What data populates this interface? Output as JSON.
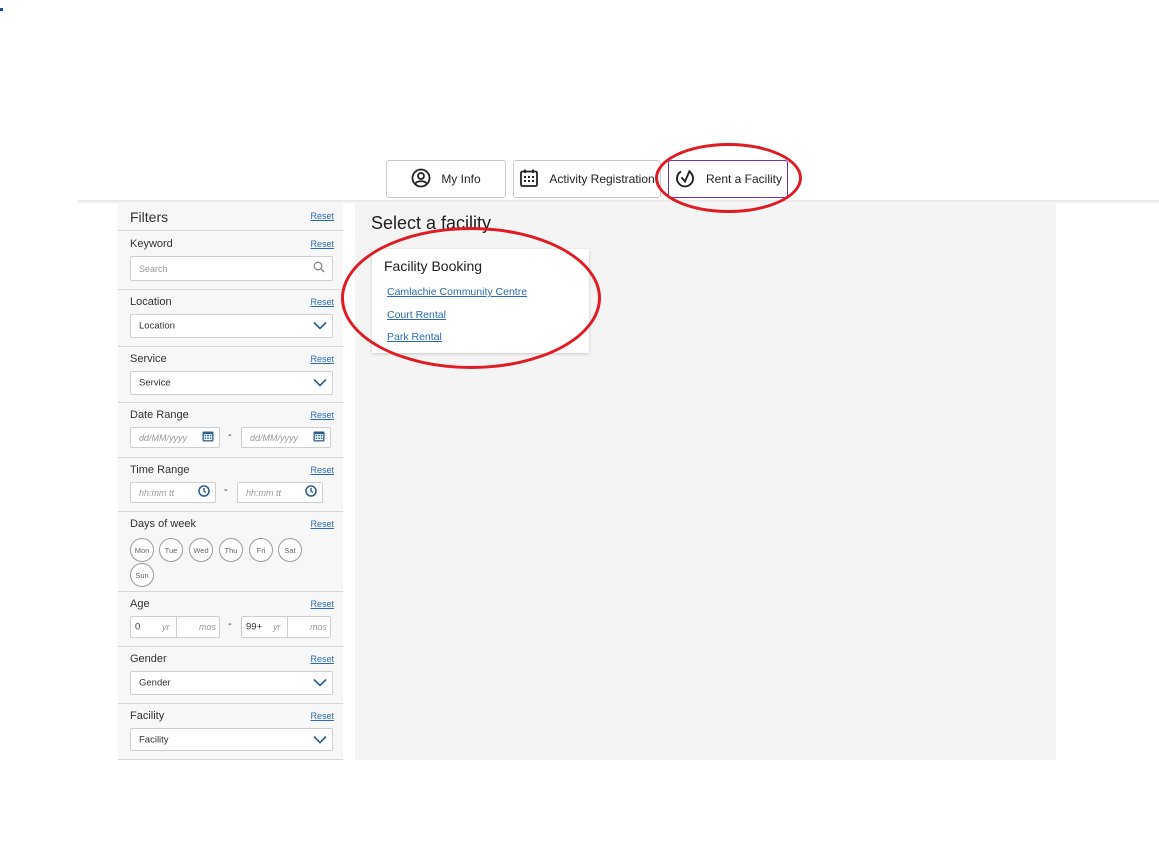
{
  "tabs": [
    {
      "label": "My Info",
      "icon": "user-circle-icon"
    },
    {
      "label": "Activity Registration",
      "icon": "calendar-icon"
    },
    {
      "label": "Rent a Facility",
      "icon": "facility-icon"
    }
  ],
  "filters": {
    "title": "Filters",
    "reset_label": "Reset",
    "keyword": {
      "label": "Keyword",
      "placeholder": "Search"
    },
    "location": {
      "label": "Location",
      "value": "Location"
    },
    "service": {
      "label": "Service",
      "value": "Service"
    },
    "date_range": {
      "label": "Date Range",
      "from_placeholder": "dd/MM/yyyy",
      "to_placeholder": "dd/MM/yyyy",
      "separator": "-"
    },
    "time_range": {
      "label": "Time Range",
      "from_placeholder": "hh:mm tt",
      "to_placeholder": "hh:mm tt",
      "separator": "-"
    },
    "days_of_week": {
      "label": "Days of week",
      "days": [
        "Mon",
        "Tue",
        "Wed",
        "Thu",
        "Fri",
        "Sat",
        "Sun"
      ]
    },
    "age": {
      "label": "Age",
      "min_years": "0",
      "max_years": "99+",
      "yr_placeholder": "yr",
      "mos_placeholder": "mos",
      "separator": "-"
    },
    "gender": {
      "label": "Gender",
      "value": "Gender"
    },
    "facility": {
      "label": "Facility",
      "value": "Facility"
    }
  },
  "main": {
    "title": "Select a facility",
    "card": {
      "title": "Facility Booking",
      "links": [
        "Camlachie Community Centre",
        "Court Rental",
        "Park Rental"
      ]
    }
  },
  "colors": {
    "accent": "#6b35b5",
    "link": "#2b6cb0",
    "annotation": "#e01b24",
    "icon_blue": "#2c5f8a"
  }
}
